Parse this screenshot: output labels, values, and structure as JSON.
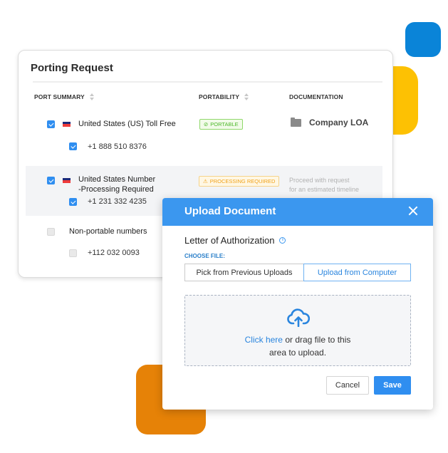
{
  "decorations": {
    "blue": "#0a84d8",
    "yellow": "#fdc103",
    "orange": "#e68207"
  },
  "porting_card": {
    "title": "Porting Request",
    "columns": [
      {
        "label": "PORT SUMMARY",
        "sortable": true
      },
      {
        "label": "PORTABILITY",
        "sortable": true
      },
      {
        "label": "DOCUMENTATION",
        "sortable": false
      }
    ],
    "groups": [
      {
        "name": "United States (US) Toll Free",
        "checked": true,
        "flag": "us-flag-icon",
        "number": "+1 888 510 8376",
        "number_checked": true,
        "status": "PORTABLE",
        "status_icon": "check-circle-icon",
        "documentation": "Company LOA",
        "documentation_icon": "folder-icon"
      },
      {
        "name_line1": "United States Number",
        "name_line2": "-Processing Required",
        "checked": true,
        "flag": "us-flag-icon",
        "number": "+1 231 332 4235",
        "number_checked": true,
        "status": "PROCESSING REQUIRED",
        "status_icon": "warning-icon",
        "note_line1": "Proceed with request",
        "note_line2": "for an estimated timeline"
      },
      {
        "name": "Non-portable numbers",
        "checked": false,
        "number": "+112 032 0093",
        "number_checked": false
      }
    ]
  },
  "modal": {
    "title": "Upload Document",
    "close_icon": "close-icon",
    "section_title": "Letter of Authorization",
    "info_glyph": "i",
    "choose_label": "CHOOSE FILE:",
    "options": [
      "Pick from Previous Uploads",
      "Upload from Computer"
    ],
    "selected_option": "Upload from Computer",
    "dropzone": {
      "icon": "cloud-upload-icon",
      "link": "Click here",
      "text_rest": " or drag file to this",
      "text_line2": "area to upload."
    },
    "cancel_label": "Cancel",
    "save_label": "Save",
    "accent": "#3b97ef"
  }
}
